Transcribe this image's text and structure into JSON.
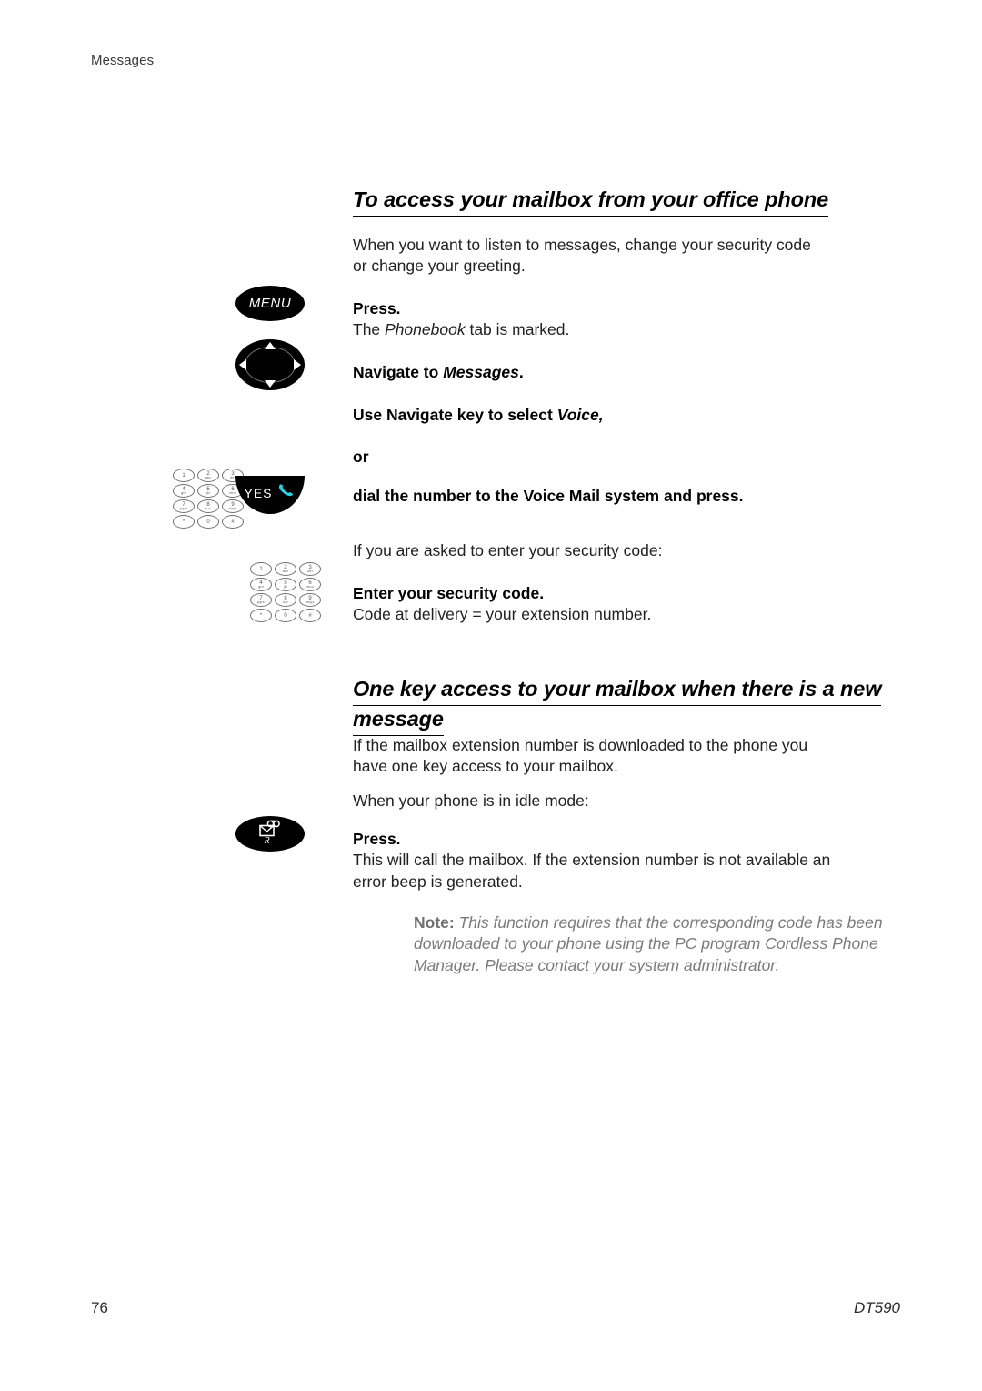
{
  "header": {
    "running_head": "Messages"
  },
  "sections": [
    {
      "heading_line1": "To access your mailbox from your office phone",
      "intro_line1": "When you want to listen to messages, change your security code",
      "intro_line2": "or change your greeting."
    },
    {
      "heading_line1": "One key access to your mailbox when there is a new ",
      "heading_line2": "message",
      "intro_line1": "If the mailbox extension number is downloaded to the phone you",
      "intro_line2": "have one key access to your mailbox.",
      "intro2": "When your phone is in idle mode:"
    }
  ],
  "steps": {
    "press_1": "Press.",
    "press_1_desc_a": "The ",
    "press_1_desc_b": "Phonebook",
    "press_1_desc_c": " tab is marked.",
    "navigate_a": "Navigate to ",
    "navigate_b": "Messages",
    "navigate_c": ".",
    "use_navigate_a": "Use Navigate key to select ",
    "use_navigate_b": "Voice,",
    "or_label": "or",
    "dial_number": "dial the number to the Voice Mail system and press.",
    "if_asked": "If you are asked to enter your security code:",
    "enter_code": "Enter your security code.",
    "code_delivery": "Code at delivery = your extension number.",
    "press_2": "Press.",
    "press_2_desc_line1": "This will call the mailbox. If the extension number is not available an",
    "press_2_desc_line2": "error beep is generated."
  },
  "icons": {
    "menu_label": "MENU",
    "yes_label": "YES",
    "mailbox_r_label": "R",
    "keypad_keys": [
      {
        "num": "1",
        "abc": ""
      },
      {
        "num": "2",
        "abc": "abc"
      },
      {
        "num": "3",
        "abc": "def"
      },
      {
        "num": "4",
        "abc": "ghi"
      },
      {
        "num": "5",
        "abc": "jkl"
      },
      {
        "num": "6",
        "abc": "mno"
      },
      {
        "num": "7",
        "abc": "pqrs"
      },
      {
        "num": "8",
        "abc": "tuv"
      },
      {
        "num": "9",
        "abc": "wxyz"
      },
      {
        "num": "*",
        "abc": ""
      },
      {
        "num": "0",
        "abc": ""
      },
      {
        "num": "#",
        "abc": ""
      }
    ],
    "handset_color": "#22d3e8"
  },
  "note": {
    "label": "Note:",
    "text": " This function requires that the corresponding code has been downloaded to your phone using the PC program Cordless Phone Manager. Please contact your system administrator."
  },
  "footer": {
    "page_number": "76",
    "document": "DT590"
  }
}
